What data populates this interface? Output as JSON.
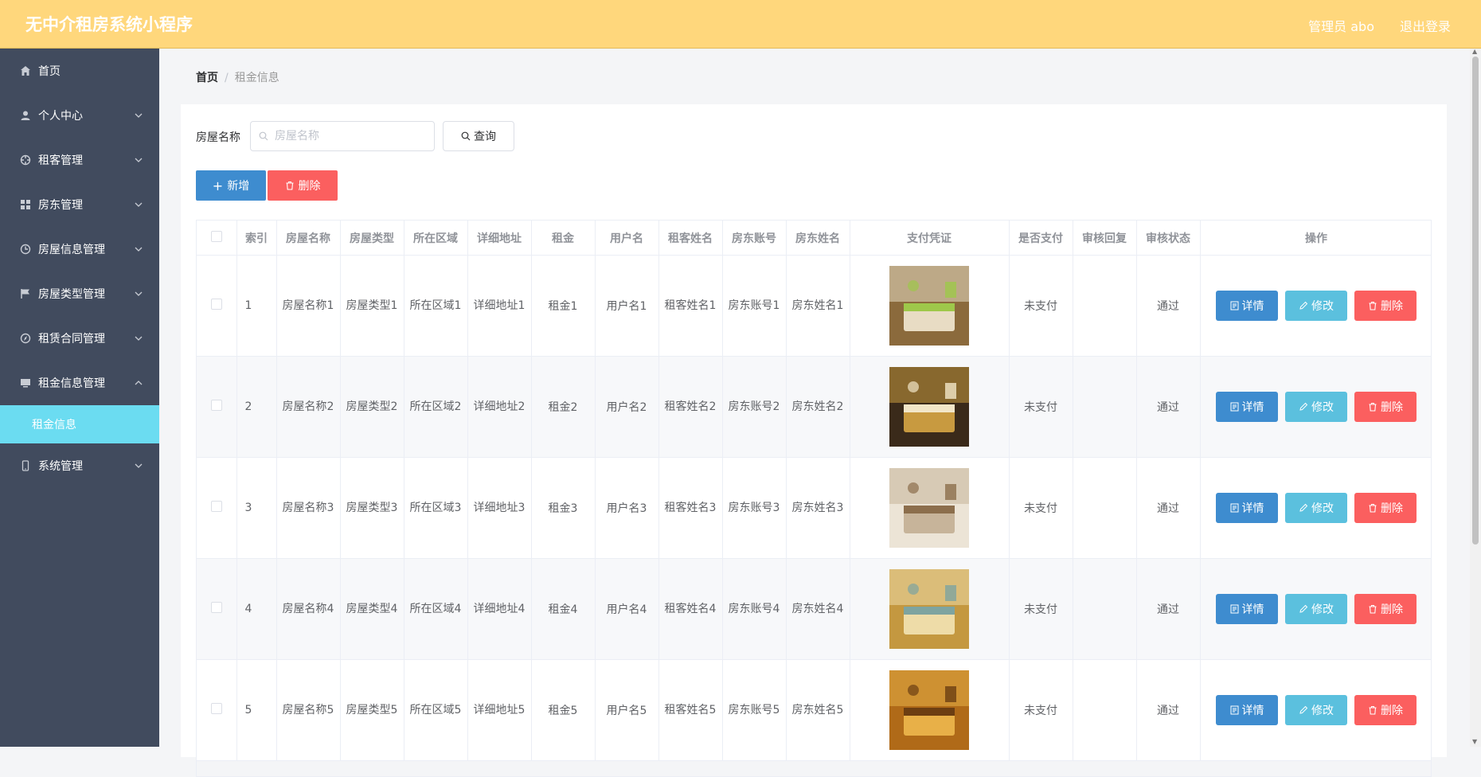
{
  "app": {
    "title": "无中介租房系统小程序"
  },
  "header": {
    "user": "管理员 abo",
    "logout": "退出登录"
  },
  "sidebar": {
    "items": [
      {
        "label": "首页",
        "icon": "home-icon",
        "expandable": false
      },
      {
        "label": "个人中心",
        "icon": "user-icon",
        "expandable": true
      },
      {
        "label": "租客管理",
        "icon": "target-icon",
        "expandable": true
      },
      {
        "label": "房东管理",
        "icon": "grid-icon",
        "expandable": true
      },
      {
        "label": "房屋信息管理",
        "icon": "clock-icon",
        "expandable": true
      },
      {
        "label": "房屋类型管理",
        "icon": "flag-icon",
        "expandable": true
      },
      {
        "label": "租赁合同管理",
        "icon": "compass-icon",
        "expandable": true
      },
      {
        "label": "租金信息管理",
        "icon": "monitor-icon",
        "expandable": true,
        "expanded": true
      },
      {
        "label": "系统管理",
        "icon": "phone-icon",
        "expandable": true
      }
    ],
    "active_sub": "租金信息"
  },
  "breadcrumb": {
    "home": "首页",
    "sep": "/",
    "current": "租金信息"
  },
  "search": {
    "label": "房屋名称",
    "placeholder": "房屋名称",
    "button": "查询"
  },
  "actions": {
    "add": "新增",
    "delete": "删除"
  },
  "table": {
    "columns": [
      "",
      "索引",
      "房屋名称",
      "房屋类型",
      "所在区域",
      "详细地址",
      "租金",
      "用户名",
      "租客姓名",
      "房东账号",
      "房东姓名",
      "支付凭证",
      "是否支付",
      "审核回复",
      "审核状态",
      "操作"
    ],
    "rows": [
      {
        "index": "1",
        "name": "房屋名称1",
        "type": "房屋类型1",
        "area": "所在区域1",
        "address": "详细地址1",
        "rent": "租金1",
        "username": "用户名1",
        "tenant": "租客姓名1",
        "landlord_account": "房东账号1",
        "landlord": "房东姓名1",
        "paid": "未支付",
        "reply": "",
        "status": "通过"
      },
      {
        "index": "2",
        "name": "房屋名称2",
        "type": "房屋类型2",
        "area": "所在区域2",
        "address": "详细地址2",
        "rent": "租金2",
        "username": "用户名2",
        "tenant": "租客姓名2",
        "landlord_account": "房东账号2",
        "landlord": "房东姓名2",
        "paid": "未支付",
        "reply": "",
        "status": "通过"
      },
      {
        "index": "3",
        "name": "房屋名称3",
        "type": "房屋类型3",
        "area": "所在区域3",
        "address": "详细地址3",
        "rent": "租金3",
        "username": "用户名3",
        "tenant": "租客姓名3",
        "landlord_account": "房东账号3",
        "landlord": "房东姓名3",
        "paid": "未支付",
        "reply": "",
        "status": "通过"
      },
      {
        "index": "4",
        "name": "房屋名称4",
        "type": "房屋类型4",
        "area": "所在区域4",
        "address": "详细地址4",
        "rent": "租金4",
        "username": "用户名4",
        "tenant": "租客姓名4",
        "landlord_account": "房东账号4",
        "landlord": "房东姓名4",
        "paid": "未支付",
        "reply": "",
        "status": "通过"
      },
      {
        "index": "5",
        "name": "房屋名称5",
        "type": "房屋类型5",
        "area": "所在区域5",
        "address": "详细地址5",
        "rent": "租金5",
        "username": "用户名5",
        "tenant": "租客姓名5",
        "landlord_account": "房东账号5",
        "landlord": "房东姓名5",
        "paid": "未支付",
        "reply": "",
        "status": "通过"
      }
    ],
    "row_actions": {
      "detail": "详情",
      "edit": "修改",
      "delete": "删除"
    }
  },
  "colors": {
    "header": "#ffd77c",
    "sidebar": "#414b5e",
    "active": "#6bdcf1",
    "primary": "#3e8ccf",
    "info": "#5bc0de",
    "danger": "#fb5f5f"
  }
}
